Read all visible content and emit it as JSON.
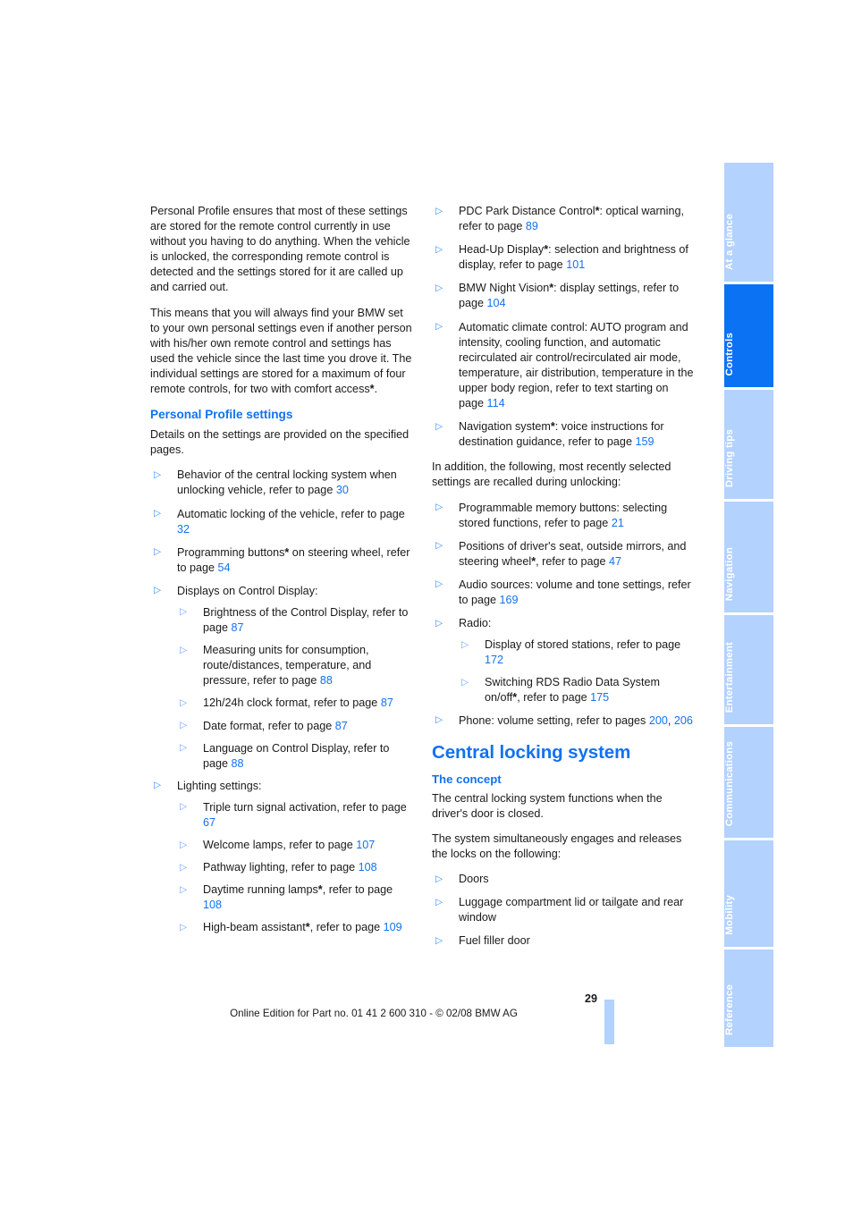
{
  "document": {
    "page_number": "29",
    "footer": "Online Edition for Part no. 01 41 2 600 310 - © 02/08 BMW AG",
    "accent_color": "#1272f0",
    "tab_inactive_color": "#b3d2fd",
    "tab_active_color": "#0b72f4"
  },
  "tabs": [
    {
      "label": "At a glance",
      "active": false
    },
    {
      "label": "Controls",
      "active": true
    },
    {
      "label": "Driving tips",
      "active": false
    },
    {
      "label": "Navigation",
      "active": false
    },
    {
      "label": "Entertainment",
      "active": false
    },
    {
      "label": "Communications",
      "active": false
    },
    {
      "label": "Mobility",
      "active": false
    },
    {
      "label": "Reference",
      "active": false
    }
  ],
  "left_column": {
    "intro_para_1": "Personal Profile ensures that most of these settings are stored for the remote control currently in use without you having to do anything. When the vehicle is unlocked, the corresponding remote control is detected and the settings stored for it are called up and carried out.",
    "intro_para_2_a": "This means that you will always find your BMW set to your own personal settings even if another person with his/her own remote control and settings has used the vehicle since the last time you drove it. The individual settings are stored for a maximum of four remote controls, for two with comfort access",
    "intro_para_2_star": "*",
    "intro_para_2_b": ".",
    "section_title": "Personal Profile settings",
    "section_intro": "Details on the settings are provided on the specified pages.",
    "items": {
      "behavior_a": "Behavior of the central locking system when unlocking vehicle, refer to page ",
      "behavior_ref": "30",
      "autolock_a": "Automatic locking of the vehicle, refer to page ",
      "autolock_ref": "32",
      "progbtn_a": "Programming buttons",
      "progbtn_star": "*",
      "progbtn_b": " on steering wheel, refer to page ",
      "progbtn_ref": "54",
      "displays_label": "Displays on Control Display:",
      "brightness_a": "Brightness of the Control Display, refer to page ",
      "brightness_ref": "87",
      "units_a": "Measuring units for consumption, route/distances, temperature, and pressure, refer to page ",
      "units_ref": "88",
      "clock_a": "12h/24h clock format, refer to page ",
      "clock_ref": "87",
      "date_a": "Date format, refer to page ",
      "date_ref": "87",
      "language_a": "Language on Control Display, refer to page ",
      "language_ref": "88",
      "lighting_label": "Lighting settings:",
      "turnsignal_a": "Triple turn signal activation, refer to page ",
      "turnsignal_ref": "67",
      "welcome_a": "Welcome lamps, refer to page ",
      "welcome_ref": "107",
      "pathway_a": "Pathway lighting, refer to page ",
      "pathway_ref": "108",
      "drl_a": "Daytime running lamps",
      "drl_star": "*",
      "drl_b": ", refer to page ",
      "drl_ref": "108",
      "highbeam_a": "High-beam assistant",
      "highbeam_star": "*",
      "highbeam_b": ", refer to page ",
      "highbeam_ref": "109"
    }
  },
  "right_column": {
    "items": {
      "pdc_a": "PDC Park Distance Control",
      "pdc_star": "*",
      "pdc_b": ": optical warning, refer to page ",
      "pdc_ref": "89",
      "hud_a": "Head-Up Display",
      "hud_star": "*",
      "hud_b": ": selection and brightness of display, refer to page ",
      "hud_ref": "101",
      "nightvision_a": "BMW Night Vision",
      "nightvision_star": "*",
      "nightvision_b": ": display settings, refer to page ",
      "nightvision_ref": "104",
      "climate_a": "Automatic climate control: AUTO program and intensity, cooling function, and automatic recirculated air control/recirculated air mode, temperature, air distribution, temperature in the upper body region, refer to text starting on page ",
      "climate_ref": "114",
      "navigation_a": "Navigation system",
      "navigation_star": "*",
      "navigation_b": ": voice instructions for destination guidance, refer to page ",
      "navigation_ref": "159"
    },
    "addition_para": "In addition, the following, most recently selected settings are recalled during unlocking:",
    "recall_items": {
      "memory_a": "Programmable memory buttons: selecting stored functions, refer to page ",
      "memory_ref": "21",
      "positions_a": "Positions of driver's seat, outside mirrors, and steering wheel",
      "positions_star": "*",
      "positions_b": ", refer to page ",
      "positions_ref": "47",
      "audio_a": "Audio sources: volume and tone settings, refer to page ",
      "audio_ref": "169",
      "radio_label": "Radio:",
      "stations_a": "Display of stored stations, refer to page ",
      "stations_ref": "172",
      "rds_a": "Switching RDS Radio Data System on/off",
      "rds_star": "*",
      "rds_b": ", refer to page ",
      "rds_ref": "175",
      "phone_a": "Phone: volume setting, refer to pages ",
      "phone_ref_1": "200",
      "phone_sep": ", ",
      "phone_ref_2": "206"
    },
    "big_title": "Central locking system",
    "sub_title": "The concept",
    "concept_para_1": "The central locking system functions when the driver's door is closed.",
    "concept_para_2": "The system simultaneously engages and releases the locks on the following:",
    "locks": {
      "doors": "Doors",
      "luggage": "Luggage compartment lid or tailgate and rear window",
      "fuel": "Fuel filler door"
    }
  }
}
